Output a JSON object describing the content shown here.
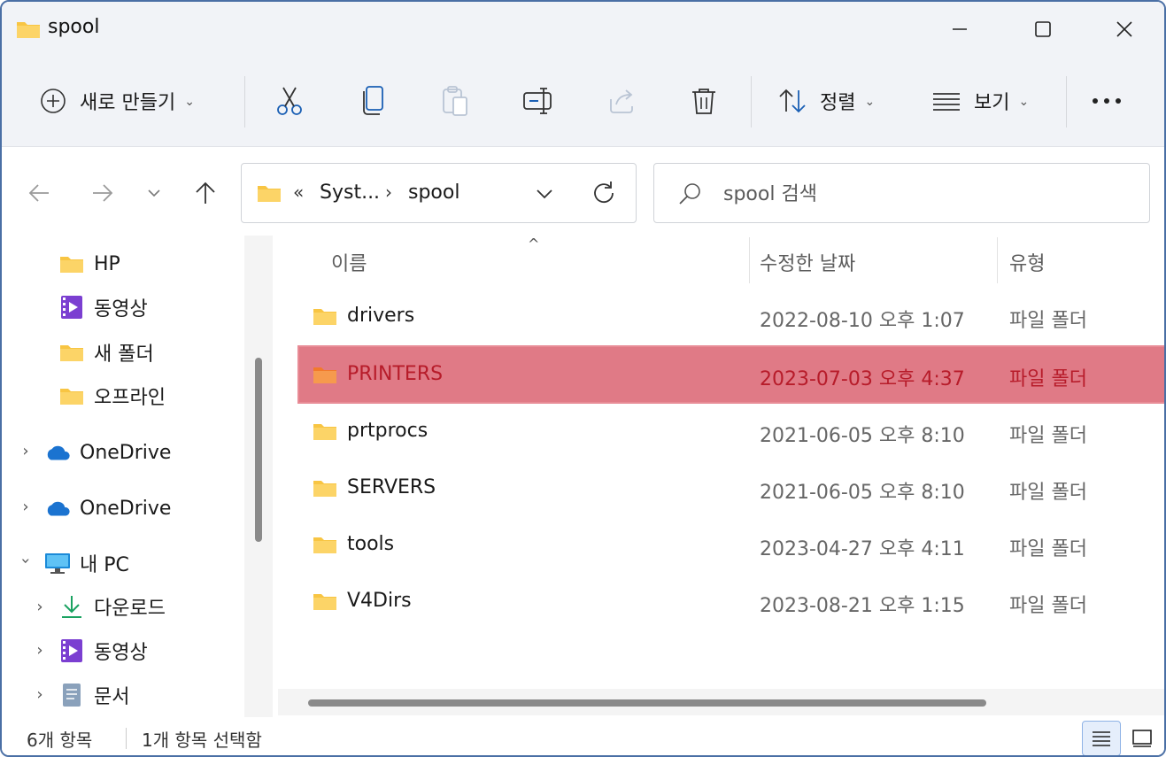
{
  "window": {
    "title": "spool"
  },
  "toolbar": {
    "new_label": "새로 만들기",
    "sort_label": "정렬",
    "view_label": "보기",
    "more_label": "···"
  },
  "address": {
    "overflow": "«",
    "segment1": "Syst...",
    "separator": "›",
    "segment2": "spool"
  },
  "search": {
    "placeholder": "spool 검색"
  },
  "sidebar": {
    "items": [
      {
        "label": "HP"
      },
      {
        "label": "동영상"
      },
      {
        "label": "새 폴더"
      },
      {
        "label": "오프라인"
      },
      {
        "label": "OneDrive"
      },
      {
        "label": "OneDrive"
      },
      {
        "label": "내 PC"
      },
      {
        "label": "다운로드"
      },
      {
        "label": "동영상"
      },
      {
        "label": "문서"
      }
    ]
  },
  "list": {
    "columns": {
      "name": "이름",
      "date": "수정한 날짜",
      "type": "유형"
    },
    "rows": [
      {
        "name": "drivers",
        "date": "2022-08-10 오후 1:07",
        "type": "파일 폴더"
      },
      {
        "name": "PRINTERS",
        "date": "2023-07-03 오후 4:37",
        "type": "파일 폴더"
      },
      {
        "name": "prtprocs",
        "date": "2021-06-05 오후 8:10",
        "type": "파일 폴더"
      },
      {
        "name": "SERVERS",
        "date": "2021-06-05 오후 8:10",
        "type": "파일 폴더"
      },
      {
        "name": "tools",
        "date": "2023-04-27 오후 4:11",
        "type": "파일 폴더"
      },
      {
        "name": "V4Dirs",
        "date": "2023-08-21 오후 1:15",
        "type": "파일 폴더"
      }
    ]
  },
  "status": {
    "count": "6개 항목",
    "selected": "1개 항목 선택함"
  },
  "colors": {
    "folder": "#f8c543",
    "folder_selected": "#f27a2b",
    "selection": "#e07a86",
    "onedrive": "#1b73d0",
    "download": "#1aa261",
    "video": "#7b3fd1"
  }
}
